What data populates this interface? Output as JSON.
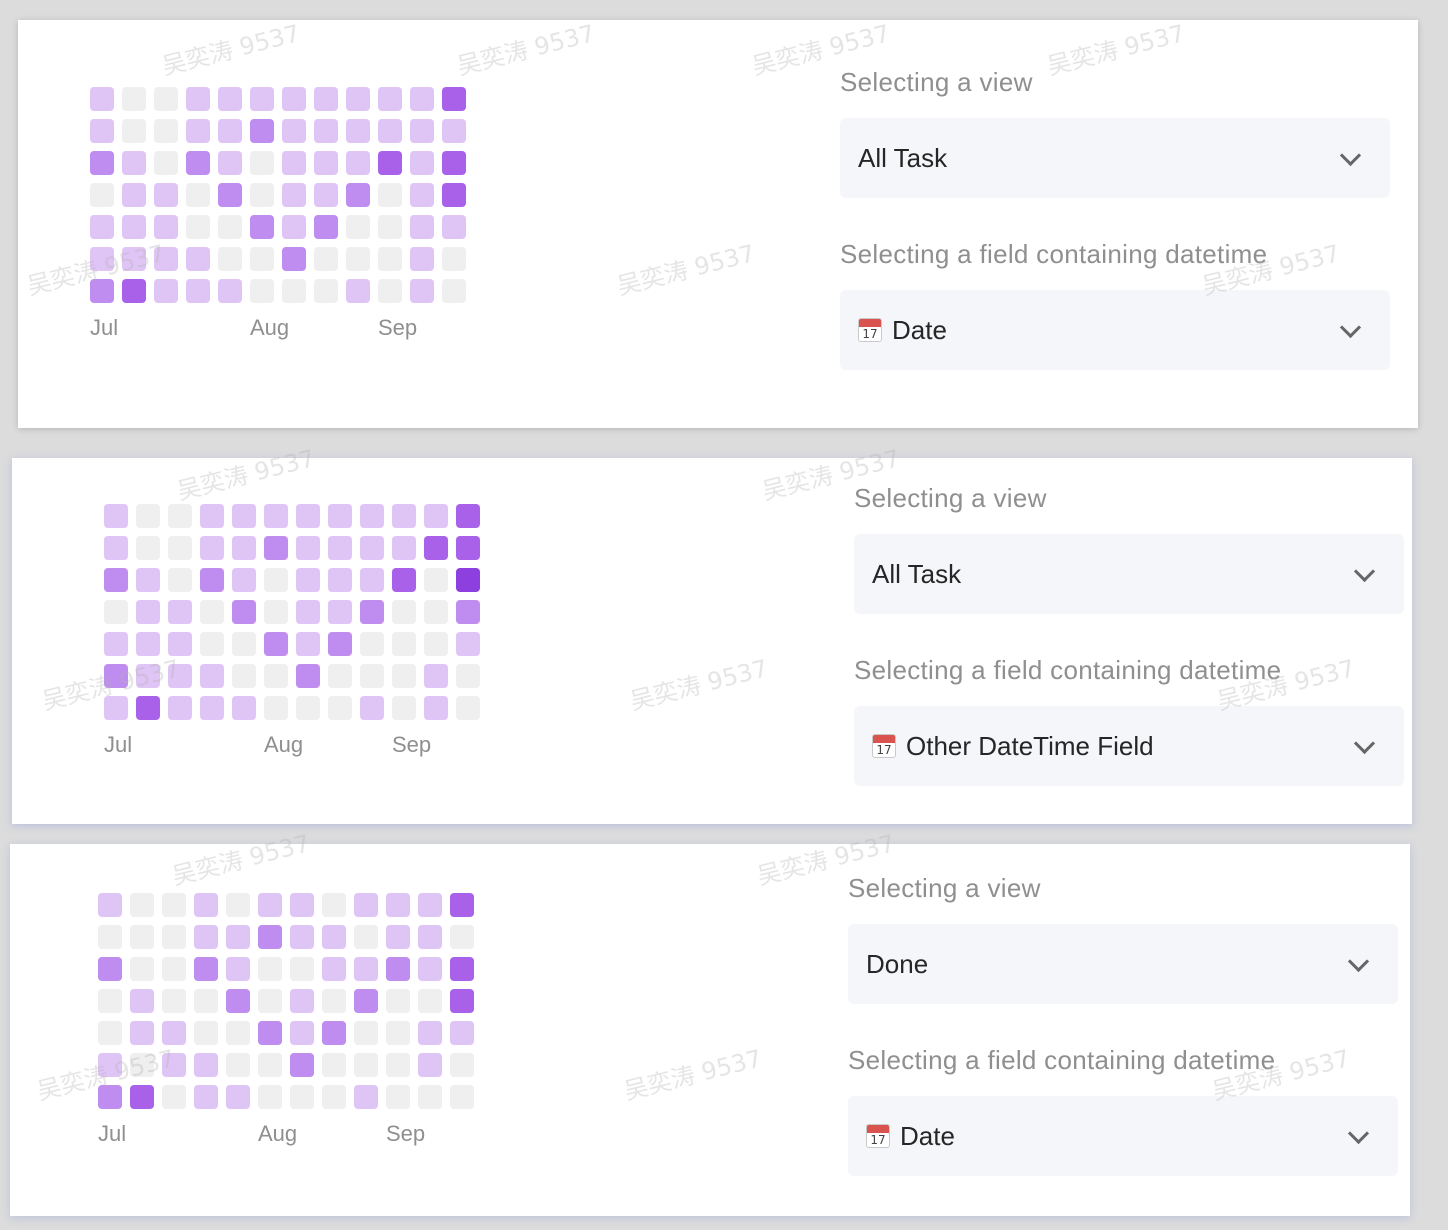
{
  "colors": {
    "level0": "#efefef",
    "level1": "#dfc4f6",
    "level2": "#bf8cf0",
    "level3": "#a861e8",
    "level4": "#8e3fe0",
    "select_bg": "#f5f6fa"
  },
  "watermark": "吴奕涛 9537",
  "panels": [
    {
      "months": [
        "Jul",
        "Aug",
        "Sep"
      ],
      "heatmap_levels": [
        [
          1,
          0,
          0,
          1,
          1,
          1,
          1,
          1,
          1,
          1,
          1,
          3
        ],
        [
          1,
          0,
          0,
          1,
          1,
          2,
          1,
          1,
          1,
          1,
          1,
          1
        ],
        [
          2,
          1,
          0,
          2,
          1,
          0,
          1,
          1,
          1,
          3,
          1,
          3
        ],
        [
          0,
          1,
          1,
          0,
          2,
          0,
          1,
          1,
          2,
          0,
          1,
          3
        ],
        [
          1,
          1,
          1,
          0,
          0,
          2,
          1,
          2,
          0,
          0,
          1,
          1
        ],
        [
          1,
          1,
          1,
          1,
          0,
          0,
          2,
          0,
          0,
          0,
          1,
          0
        ],
        [
          2,
          3,
          1,
          1,
          1,
          0,
          0,
          0,
          1,
          0,
          1,
          0
        ]
      ],
      "view_label": "Selecting a view",
      "view_value": "All Task",
      "field_label": "Selecting a field containing datetime",
      "field_value": "Date",
      "field_icon": "calendar-icon",
      "calendar_day": "17"
    },
    {
      "months": [
        "Jul",
        "Aug",
        "Sep"
      ],
      "heatmap_levels": [
        [
          1,
          0,
          0,
          1,
          1,
          1,
          1,
          1,
          1,
          1,
          1,
          3
        ],
        [
          1,
          0,
          0,
          1,
          1,
          2,
          1,
          1,
          1,
          1,
          3,
          3
        ],
        [
          2,
          1,
          0,
          2,
          1,
          0,
          1,
          1,
          1,
          3,
          0,
          4
        ],
        [
          0,
          1,
          1,
          0,
          2,
          0,
          1,
          1,
          2,
          0,
          0,
          2
        ],
        [
          1,
          1,
          1,
          0,
          0,
          2,
          1,
          2,
          0,
          0,
          0,
          1
        ],
        [
          2,
          1,
          1,
          1,
          0,
          0,
          2,
          0,
          0,
          0,
          1,
          0
        ],
        [
          1,
          3,
          1,
          1,
          1,
          0,
          0,
          0,
          1,
          0,
          1,
          0
        ]
      ],
      "view_label": "Selecting a view",
      "view_value": "All Task",
      "field_label": "Selecting a field containing datetime",
      "field_value": "Other DateTime Field",
      "field_icon": "calendar-icon",
      "calendar_day": "17"
    },
    {
      "months": [
        "Jul",
        "Aug",
        "Sep"
      ],
      "heatmap_levels": [
        [
          1,
          0,
          0,
          1,
          0,
          1,
          1,
          0,
          1,
          1,
          1,
          3
        ],
        [
          0,
          0,
          0,
          1,
          1,
          2,
          1,
          1,
          0,
          1,
          1,
          0
        ],
        [
          2,
          0,
          0,
          2,
          1,
          0,
          0,
          1,
          1,
          2,
          1,
          3
        ],
        [
          0,
          1,
          0,
          0,
          2,
          0,
          1,
          0,
          2,
          0,
          0,
          3
        ],
        [
          0,
          1,
          1,
          0,
          0,
          2,
          1,
          2,
          0,
          0,
          1,
          1
        ],
        [
          1,
          0,
          1,
          1,
          0,
          0,
          2,
          0,
          0,
          0,
          1,
          0
        ],
        [
          2,
          3,
          0,
          1,
          1,
          0,
          0,
          0,
          1,
          0,
          0,
          0
        ]
      ],
      "view_label": "Selecting a view",
      "view_value": "Done",
      "field_label": "Selecting a field containing datetime",
      "field_value": "Date",
      "field_icon": "calendar-icon",
      "calendar_day": "17"
    }
  ]
}
